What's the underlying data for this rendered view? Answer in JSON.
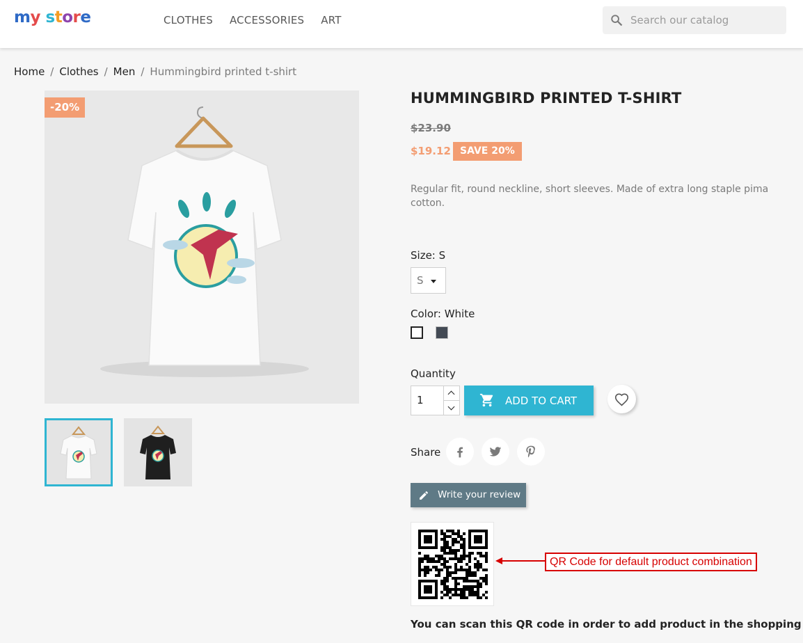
{
  "header": {
    "logo": {
      "part1": "my",
      "part2": "store"
    },
    "nav": [
      "CLOTHES",
      "ACCESSORIES",
      "ART"
    ],
    "search_placeholder": "Search our catalog"
  },
  "breadcrumb": [
    {
      "label": "Home"
    },
    {
      "label": "Clothes"
    },
    {
      "label": "Men"
    },
    {
      "label": "Hummingbird printed t-shirt"
    }
  ],
  "product": {
    "discount_flag": "-20%",
    "title": "HUMMINGBIRD PRINTED T-SHIRT",
    "regular_price": "$23.90",
    "price": "$19.12",
    "save_label": "SAVE 20%",
    "description": "Regular fit, round neckline, short sleeves. Made of extra long staple pima cotton.",
    "size_label": "Size: S",
    "size_value": "S",
    "color_label": "Color: White",
    "colors": [
      {
        "name": "White",
        "hex": "#ffffff"
      },
      {
        "name": "Black",
        "hex": "#434a54"
      }
    ],
    "quantity_label": "Quantity",
    "quantity_value": "1",
    "add_to_cart": "ADD TO CART",
    "share_label": "Share",
    "review_button": "Write your review",
    "qr_callout": "QR Code for default product combination",
    "qr_note": "You can scan this QR code in order to add product in the shopping cart"
  },
  "colors": {
    "accent": "#2fb5d2",
    "discount": "#f39d72",
    "review_button": "#5f7a86",
    "callout_red": "#d70000"
  }
}
